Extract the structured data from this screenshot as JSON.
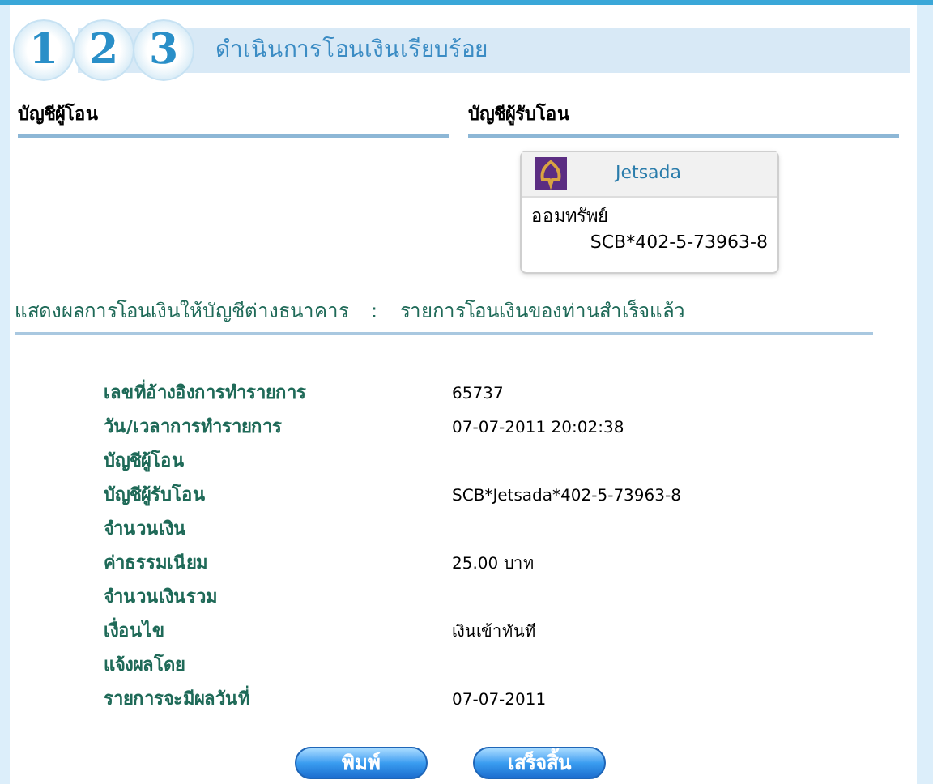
{
  "steps": [
    "1",
    "2",
    "3"
  ],
  "title": "ดำเนินการโอนเงินเรียบร้อย",
  "from_account": {
    "heading": "บัญชีผู้โอน"
  },
  "to_account": {
    "heading": "บัญชีผู้รับโอน",
    "name": "Jetsada",
    "type": "ออมทรัพย์",
    "number": "SCB*402-5-73963-8"
  },
  "result": {
    "label": "แสดงผลการโอนเงินให้บัญชีต่างธนาคาร",
    "separator": ":",
    "message": "รายการโอนเงินของท่านสำเร็จแล้ว"
  },
  "details": [
    {
      "label": "เลขที่อ้างอิงการทำรายการ",
      "value": "65737"
    },
    {
      "label": "วัน/เวลาการทำรายการ",
      "value": "07-07-2011 20:02:38"
    },
    {
      "label": "บัญชีผู้โอน"
    },
    {
      "label": "บัญชีผู้รับโอน",
      "value": "SCB*Jetsada*402-5-73963-8"
    },
    {
      "label": "จำนวนเงิน"
    },
    {
      "label": "ค่าธรรมเนียม",
      "value": "25.00 บาท"
    },
    {
      "label": "จำนวนเงินรวม"
    },
    {
      "label": "เงื่อนไข",
      "value": "เงินเข้าทันที"
    },
    {
      "label": "แจ้งผลโดย"
    },
    {
      "label": "รายการจะมีผลวันที่",
      "value": "07-07-2011"
    }
  ],
  "buttons": [
    "พิมพ์",
    "เสร็จสิ้น"
  ]
}
